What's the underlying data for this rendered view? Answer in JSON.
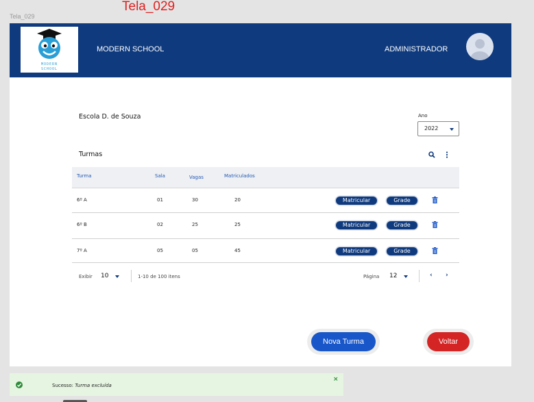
{
  "frame": {
    "label": "Tela_029",
    "title": "Tela_029"
  },
  "header": {
    "logo_text_line1": "MODERN",
    "logo_text_line2": "SCHOOL",
    "school_name": "MODERN SCHOOL",
    "user_role": "ADMINISTRADOR"
  },
  "main": {
    "school": "Escola D. de Souza",
    "year_label": "Ano",
    "year_value": "2022",
    "section_title": "Turmas"
  },
  "table": {
    "headers": [
      "Turma",
      "Sala",
      "Vagas",
      "Matriculados"
    ],
    "rows": [
      {
        "turma": "6º A",
        "sala": "01",
        "vagas": "30",
        "matriculados": "20"
      },
      {
        "turma": "6º B",
        "sala": "02",
        "vagas": "25",
        "matriculados": "25"
      },
      {
        "turma": "7º A",
        "sala": "05",
        "vagas": "05",
        "matriculados": "45"
      }
    ],
    "enroll_label": "Matricular",
    "grid_label": "Grade"
  },
  "pagination": {
    "show_label": "Exibir",
    "page_size": "10",
    "range_text": "1-10 de 100 itens",
    "page_label": "Página",
    "page_value": "12",
    "prev": "‹",
    "next": "›"
  },
  "actions": {
    "new_class": "Nova Turma",
    "back": "Voltar"
  },
  "toast": {
    "prefix": "Sucesso:",
    "message": "Turma excluída",
    "close": "×"
  },
  "colors": {
    "primary": "#0f3a7e",
    "danger": "#d42424",
    "button_blue": "#1856c9",
    "success": "#2e8b3a"
  }
}
